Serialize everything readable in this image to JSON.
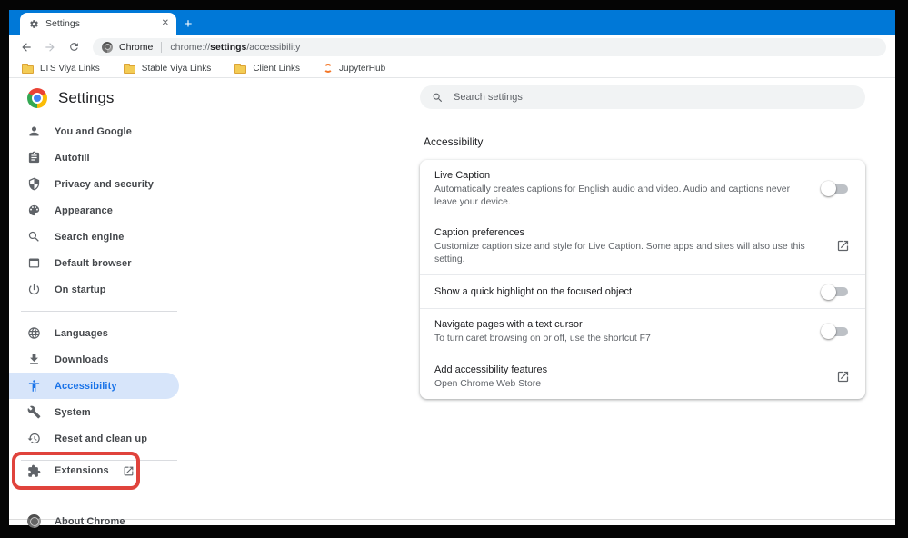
{
  "window": {
    "tab": {
      "title": "Settings"
    },
    "new_tab_label": "+",
    "address": {
      "engine_label": "Chrome",
      "url_prefix": "chrome://",
      "url_bold": "settings",
      "url_suffix": "/accessibility"
    },
    "bookmarks": [
      {
        "label": "LTS Viya Links",
        "icon": "folder-icon"
      },
      {
        "label": "Stable Viya Links",
        "icon": "folder-icon"
      },
      {
        "label": "Client Links",
        "icon": "folder-icon"
      },
      {
        "label": "JupyterHub",
        "icon": "jupyterhub-icon"
      }
    ]
  },
  "sidebar": {
    "title": "Settings",
    "items": [
      {
        "label": "You and Google",
        "icon": "person-icon"
      },
      {
        "label": "Autofill",
        "icon": "clipboard-icon"
      },
      {
        "label": "Privacy and security",
        "icon": "shield-icon"
      },
      {
        "label": "Appearance",
        "icon": "palette-icon"
      },
      {
        "label": "Search engine",
        "icon": "search-icon"
      },
      {
        "label": "Default browser",
        "icon": "browser-window-icon"
      },
      {
        "label": "On startup",
        "icon": "power-icon"
      },
      {
        "label": "Languages",
        "icon": "globe-icon"
      },
      {
        "label": "Downloads",
        "icon": "download-icon"
      },
      {
        "label": "Accessibility",
        "icon": "accessibility-icon",
        "selected": true
      },
      {
        "label": "System",
        "icon": "wrench-icon"
      },
      {
        "label": "Reset and clean up",
        "icon": "history-icon"
      },
      {
        "label": "Extensions",
        "icon": "puzzle-icon",
        "annotated": "red-highlight-box"
      },
      {
        "label": "About Chrome",
        "icon": "chrome-outline-icon"
      }
    ]
  },
  "search": {
    "placeholder": "Search settings"
  },
  "main": {
    "heading": "Accessibility",
    "rows": [
      {
        "title": "Live Caption",
        "description": "Automatically creates captions for English audio and video. Audio and captions never leave your device.",
        "control": "toggle",
        "state": "off"
      },
      {
        "title": "Caption preferences",
        "description": "Customize caption size and style for Live Caption. Some apps and sites will also use this setting.",
        "control": "external-link"
      },
      {
        "title": "Show a quick highlight on the focused object",
        "description": "",
        "control": "toggle",
        "state": "off"
      },
      {
        "title": "Navigate pages with a text cursor",
        "description": "To turn caret browsing on or off, use the shortcut F7",
        "control": "toggle",
        "state": "off"
      },
      {
        "title": "Add accessibility features",
        "description": "Open Chrome Web Store",
        "control": "external-link"
      }
    ]
  },
  "colors": {
    "titlebar_blue": "#0078d7",
    "omnibox_bg": "#f1f3f4",
    "accent_blue": "#1a73e8",
    "selected_item_bg": "#d7e5fa",
    "annotation_red": "#e0433c",
    "folder_yellow": "#f3cc55",
    "jupyter_orange": "#f37626",
    "toggle_off": "#bdc1c6"
  }
}
